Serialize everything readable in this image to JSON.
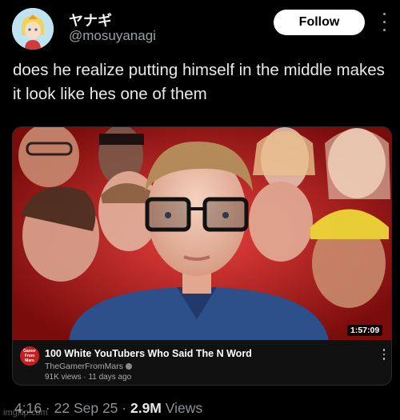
{
  "author": {
    "display_name": "ヤナギ",
    "handle": "@mosuyanagi",
    "avatar_icon": "anime-avatar-icon"
  },
  "follow_label": "Follow",
  "tweet_text": "does he realize putting himself in the middle makes it look like hes one of them",
  "video": {
    "duration": "1:57:09",
    "title": "100 White YouTubers Who Said The N Word",
    "channel": "TheGamerFromMars",
    "channel_avatar_text": "Gamer From Mars",
    "meta": "91K views · 11 days ago"
  },
  "footer": {
    "time": "4:16",
    "date": "22 Sep 25",
    "views": "2.9M",
    "views_label": "Views"
  },
  "watermark": "imgflip.com",
  "colors": {
    "background": "#000000",
    "follow_bg": "#ffffff",
    "channel_red": "#c41f1f",
    "thumb_red": "#d11a1a"
  }
}
